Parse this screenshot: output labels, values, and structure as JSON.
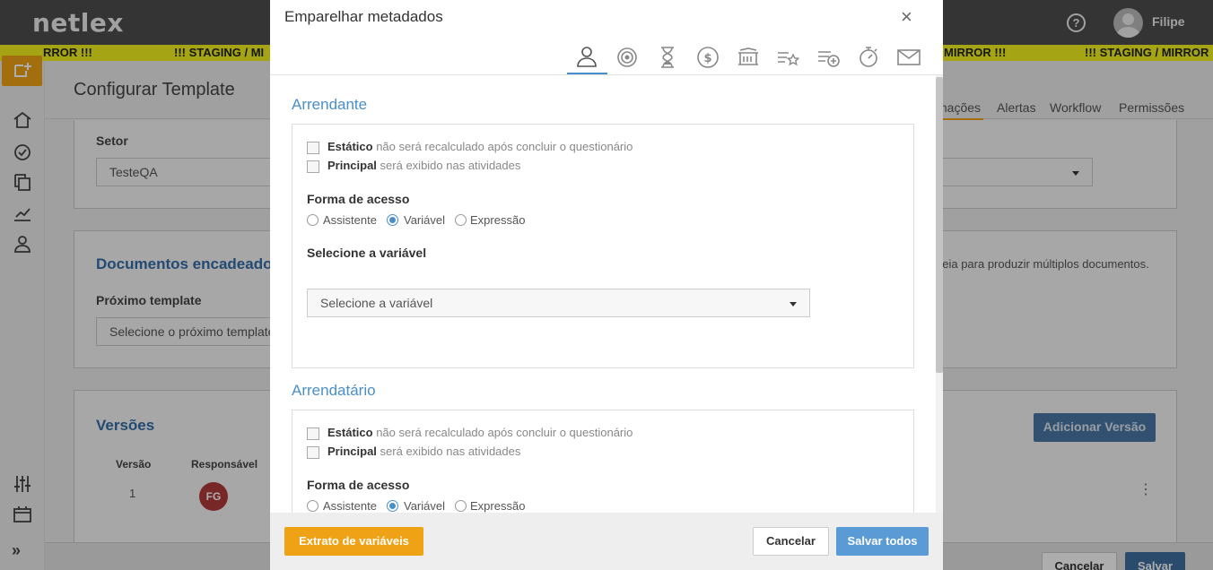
{
  "app": {
    "logo": "netlex",
    "user_name": "Filipe",
    "help_label": "?",
    "staging_banner": [
      "RROR !!!",
      "!!! STAGING / MI",
      "MIRROR !!!",
      "!!! STAGING / MIRROR"
    ]
  },
  "page": {
    "title": "Configurar Template",
    "tabs": [
      "mações",
      "Alertas",
      "Workflow",
      "Permissões"
    ],
    "setor": {
      "label": "Setor",
      "value": "TesteQA"
    },
    "documentos": {
      "title": "Documentos encadeados",
      "hint": "deia para produzir múltiplos documentos.",
      "proximo_label": "Próximo template",
      "proximo_placeholder": "Selecione o próximo template"
    },
    "versoes": {
      "title": "Versões",
      "add_button": "Adicionar Versão",
      "columns": [
        "Versão",
        "Responsável"
      ],
      "rows": [
        {
          "versao": "1",
          "responsavel_initials": "FG"
        }
      ]
    },
    "footer": {
      "cancel": "Cancelar",
      "save": "Salvar"
    }
  },
  "modal": {
    "title": "Emparelhar metadados",
    "close": "×",
    "tab_icons": [
      "person-icon",
      "target-icon",
      "hourglass-icon",
      "dollar-icon",
      "bank-icon",
      "list-star-icon",
      "list-add-icon",
      "stopwatch-icon",
      "mail-icon"
    ],
    "parties": [
      {
        "title": "Arrendante",
        "estatico_label": "Estático",
        "estatico_desc": "não será recalculado após concluir o questionário",
        "principal_label": "Principal",
        "principal_desc": "será exibido nas atividades",
        "forma_label": "Forma de acesso",
        "options": [
          "Assistente",
          "Variável",
          "Expressão"
        ],
        "selected_option": "Variável",
        "variavel_label": "Selecione a variável",
        "variavel_placeholder": "Selecione a variável"
      },
      {
        "title": "Arrendatário",
        "estatico_label": "Estático",
        "estatico_desc": "não será recalculado após concluir o questionário",
        "principal_label": "Principal",
        "principal_desc": "será exibido nas atividades",
        "forma_label": "Forma de acesso",
        "options": [
          "Assistente",
          "Variável",
          "Expressão"
        ],
        "selected_option": "Variável"
      }
    ],
    "footer": {
      "extract_button": "Extrato de variáveis",
      "cancel_button": "Cancelar",
      "save_all_button": "Salvar todos"
    }
  },
  "colors": {
    "accent_orange": "#f0a216",
    "accent_blue": "#4a8fc7",
    "staging_yellow": "#f2f21e"
  }
}
